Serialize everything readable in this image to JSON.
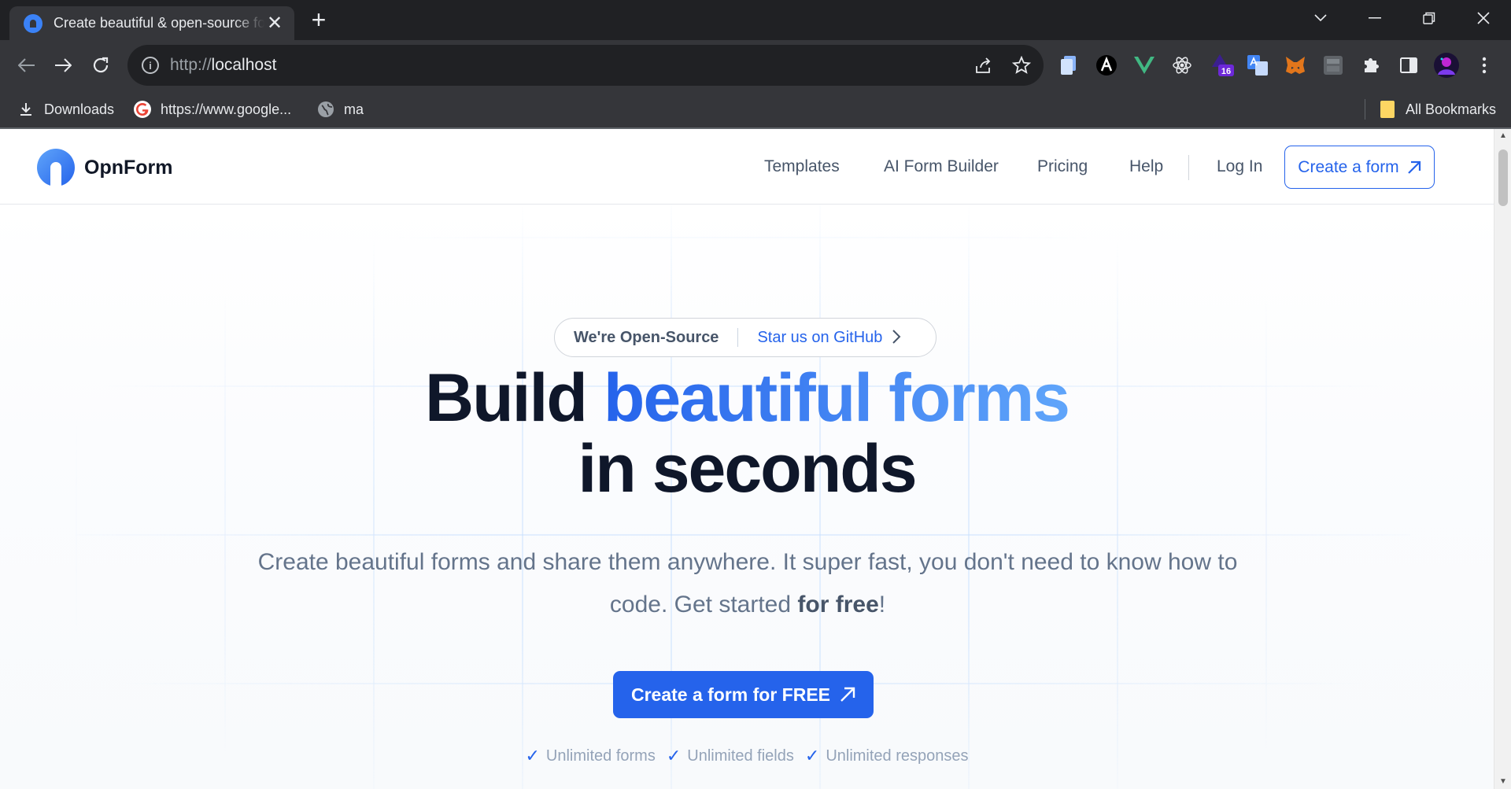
{
  "browser": {
    "tab_title": "Create beautiful & open-source forms for free",
    "new_tab_symbol": "+",
    "url_scheme": "http://",
    "url_host": "localhost",
    "extension_badge": "16",
    "bookmarks": [
      {
        "label": "Downloads",
        "icon": "download-icon"
      },
      {
        "label": "https://www.google...",
        "icon": "google-icon"
      },
      {
        "label": "ma",
        "icon": "globe-icon"
      }
    ],
    "all_bookmarks_label": "All Bookmarks"
  },
  "site": {
    "brand": "OpnForm",
    "nav": {
      "templates": "Templates",
      "ai_builder": "AI Form Builder",
      "pricing": "Pricing",
      "help": "Help",
      "login": "Log In",
      "create": "Create a form"
    },
    "hero": {
      "pill_left": "We're Open-Source",
      "pill_right": "Star us on GitHub",
      "title_plain": "Build",
      "title_accent": "beautiful forms",
      "title_line2": "in seconds",
      "lead_main": "Create beautiful forms and share them anywhere. It super fast, you don't need to know how to code. Get started",
      "lead_bold": "for free",
      "lead_end": "!",
      "cta": "Create a form for FREE",
      "features": [
        "Unlimited forms",
        "Unlimited fields",
        "Unlimited responses"
      ]
    }
  },
  "colors": {
    "accent": "#2563eb",
    "chrome_dark": "#202124",
    "chrome_toolbar": "#35363a"
  }
}
